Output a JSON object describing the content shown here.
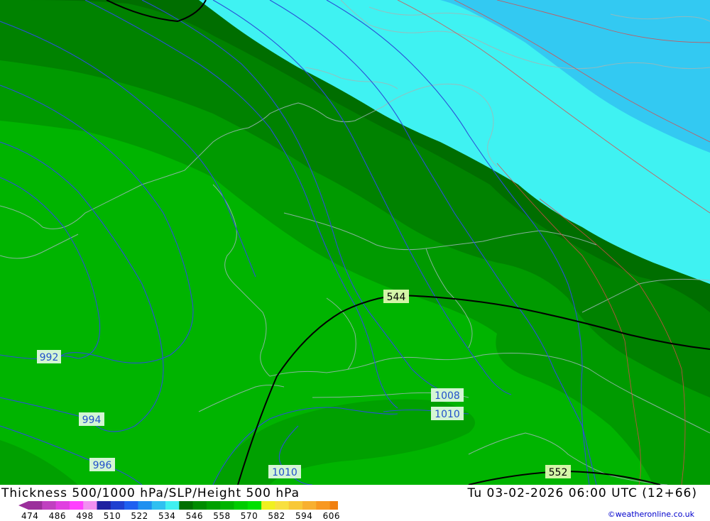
{
  "map": {
    "contour_labels": {
      "isobar_992": "992",
      "isobar_994": "994",
      "isobar_996": "996",
      "isobar_1008": "1008",
      "isobar_1010_east": "1010",
      "isobar_1010_south": "1010",
      "height_544": "544",
      "height_552": "552"
    }
  },
  "footer": {
    "title": "Thickness 500/1000 hPa/SLP/Height 500 hPa",
    "datetime": "Tu 03-02-2026 06:00 UTC (12+66)",
    "credit": "©weatheronline.co.uk"
  },
  "legend": {
    "ticks": [
      "474",
      "486",
      "498",
      "510",
      "522",
      "534",
      "546",
      "558",
      "570",
      "582",
      "594",
      "606"
    ],
    "colors": [
      "#9b2f9b",
      "#c040c0",
      "#e040e0",
      "#ff40ff",
      "#f090f0",
      "#2020a0",
      "#2040d0",
      "#2060f0",
      "#2090f0",
      "#30c0f0",
      "#40f0f0",
      "#007000",
      "#008c00",
      "#00a000",
      "#00b400",
      "#00cc00",
      "#00e000",
      "#f0f020",
      "#f8e040",
      "#f8c838",
      "#f8b030",
      "#f89820",
      "#f08010"
    ]
  }
}
